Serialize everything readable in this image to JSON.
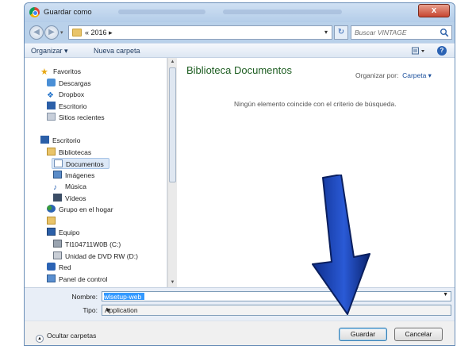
{
  "window": {
    "title": "Guardar como",
    "close_glyph": "x"
  },
  "address": {
    "path_prefix": "«",
    "path_current": "2016",
    "search_placeholder": "Buscar VINTAGE"
  },
  "toolbar": {
    "organize": "Organizar ▾",
    "new_folder": "Nueva carpeta"
  },
  "sidebar": {
    "favorites_header": "Favoritos",
    "favorites": [
      "Descargas",
      "Dropbox",
      "Escritorio",
      "Sitios recientes"
    ],
    "desktop_header": "Escritorio",
    "libraries": "Bibliotecas",
    "library_items": [
      "Documentos",
      "Imágenes",
      "Música",
      "Vídeos"
    ],
    "homegroup": "Grupo en el hogar",
    "computer": "Equipo",
    "drives": [
      "TI104711W0B (C:)",
      "Unidad de DVD RW (D:)"
    ],
    "network": "Red",
    "control_panel": "Panel de control",
    "selected": "Documentos"
  },
  "content": {
    "library_title": "Biblioteca Documentos",
    "arrange_label": "Organizar por:",
    "arrange_value": "Carpeta ▾",
    "empty_message": "Ningún elemento coincide con el criterio de búsqueda."
  },
  "form": {
    "name_label": "Nombre:",
    "name_value": "wlsetup-web",
    "type_label": "Tipo:",
    "type_value": "Application"
  },
  "bottom": {
    "hide_folders": "Ocultar carpetas",
    "save": "Guardar",
    "cancel": "Cancelar"
  },
  "colors": {
    "annotation_arrow": "#1f47b8",
    "library_title": "#1e5e22",
    "selection": "#3399ff"
  }
}
